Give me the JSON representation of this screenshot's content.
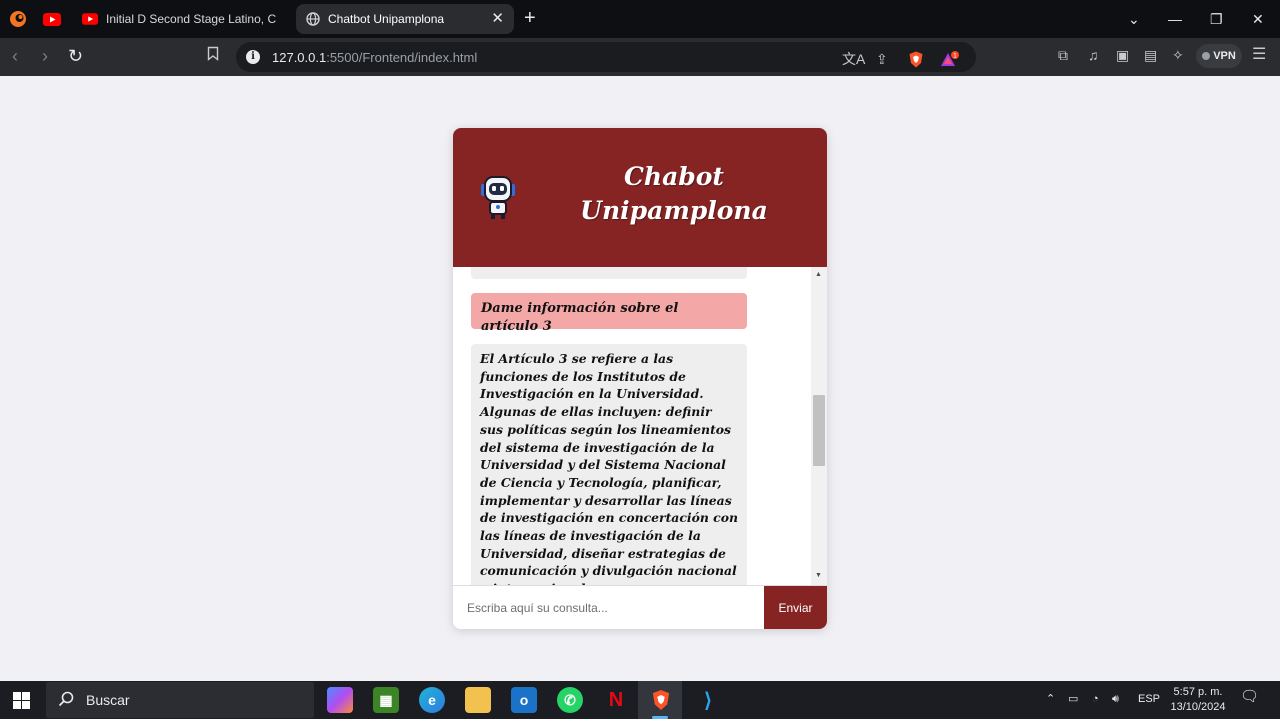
{
  "browser": {
    "tabs": [
      {
        "title": "Initial D Second Stage Latino, Capítu",
        "active": false
      },
      {
        "title": "Chatbot Unipamplona",
        "active": true
      }
    ],
    "address": {
      "host": "127.0.0.1",
      "path": ":5500/Frontend/index.html"
    },
    "vpn_label": "VPN",
    "notification_count": "1"
  },
  "chat": {
    "title_line1": "Chabot",
    "title_line2": "Unipamplona",
    "messages": [
      {
        "role": "user",
        "text": "Dame información sobre el artículo 3"
      },
      {
        "role": "bot",
        "text": "El Artículo 3 se refiere a las funciones de los Institutos de Investigación en la Universidad. Algunas de ellas incluyen: definir sus políticas según los lineamientos del sistema de investigación de la Universidad y del Sistema Nacional de Ciencia y Tecnología, planificar, implementar y desarrollar las líneas de investigación en concertación con las líneas de investigación de la Universidad, diseñar estrategias de comunicación y divulgación nacional e internacional"
      }
    ],
    "input_placeholder": "Escriba aquí su consulta...",
    "send_label": "Enviar",
    "colors": {
      "header": "#862424",
      "user_bubble": "#f4a7a7",
      "bot_bubble": "#eeeeee"
    }
  },
  "taskbar": {
    "search_label": "Buscar",
    "language": "ESP",
    "time": "5:57 p. m.",
    "date": "13/10/2024"
  }
}
